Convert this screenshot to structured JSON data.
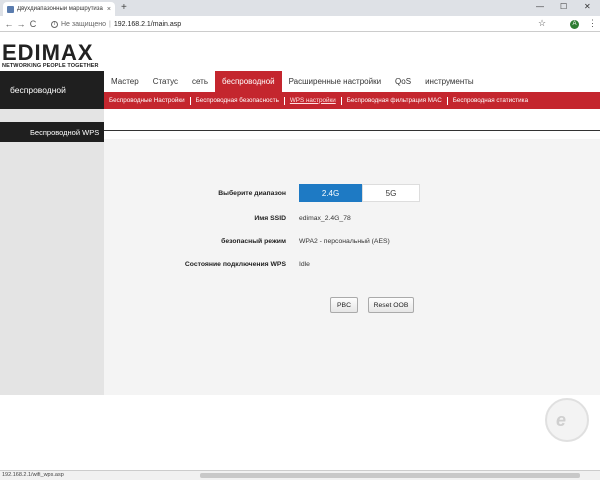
{
  "browser": {
    "tab_title": "Двухдиапазонный маршрутиза",
    "tab_close": "×",
    "new_tab": "+",
    "win_minimize": "—",
    "win_maximize": "☐",
    "win_close": "✕",
    "back": "←",
    "forward": "→",
    "reload": "C",
    "insecure_label": "Не защищено",
    "address_sep": "|",
    "url": "192.168.2.1/main.asp",
    "star": "☆",
    "menu": "⋮",
    "profile_initial": "A",
    "status_url": "192.168.2.1/wifi_wps.asp"
  },
  "brand": {
    "logo_text": "EDIMAX",
    "tagline": "NETWORKING PEOPLE TOGETHER"
  },
  "sidebar": {
    "section_title": "беспроводной",
    "active_item": "Беспроводной WPS"
  },
  "main_nav": [
    {
      "label": "Мастер"
    },
    {
      "label": "Статус"
    },
    {
      "label": "сеть"
    },
    {
      "label": "беспроводной",
      "active": true
    },
    {
      "label": "Расширенные настройки"
    },
    {
      "label": "QoS"
    },
    {
      "label": "инструменты"
    }
  ],
  "sub_nav": [
    {
      "label": "Беспроводные Настройки"
    },
    {
      "label": "Беспроводная безопасность"
    },
    {
      "label": "WPS настройки",
      "active": true
    },
    {
      "label": "Беспроводная фильтрация MAC"
    },
    {
      "label": "Беспроводная статистика"
    }
  ],
  "form": {
    "band_label": "Выберите диапазон",
    "band_24": "2.4G",
    "band_5": "5G",
    "ssid_label": "Имя SSID",
    "ssid_value": "edimax_2.4G_78",
    "security_label": "безопасный режим",
    "security_value": "WPA2 - персональный (AES)",
    "wps_state_label": "Состояние подключения WPS",
    "wps_state_value": "Idle",
    "pbc_button": "PBC",
    "reset_oob_button": "Reset OOB"
  },
  "colors": {
    "accent_red": "#c4262e",
    "selected_blue": "#1e7ac4",
    "sidebar_dark": "#1f1f1f"
  }
}
